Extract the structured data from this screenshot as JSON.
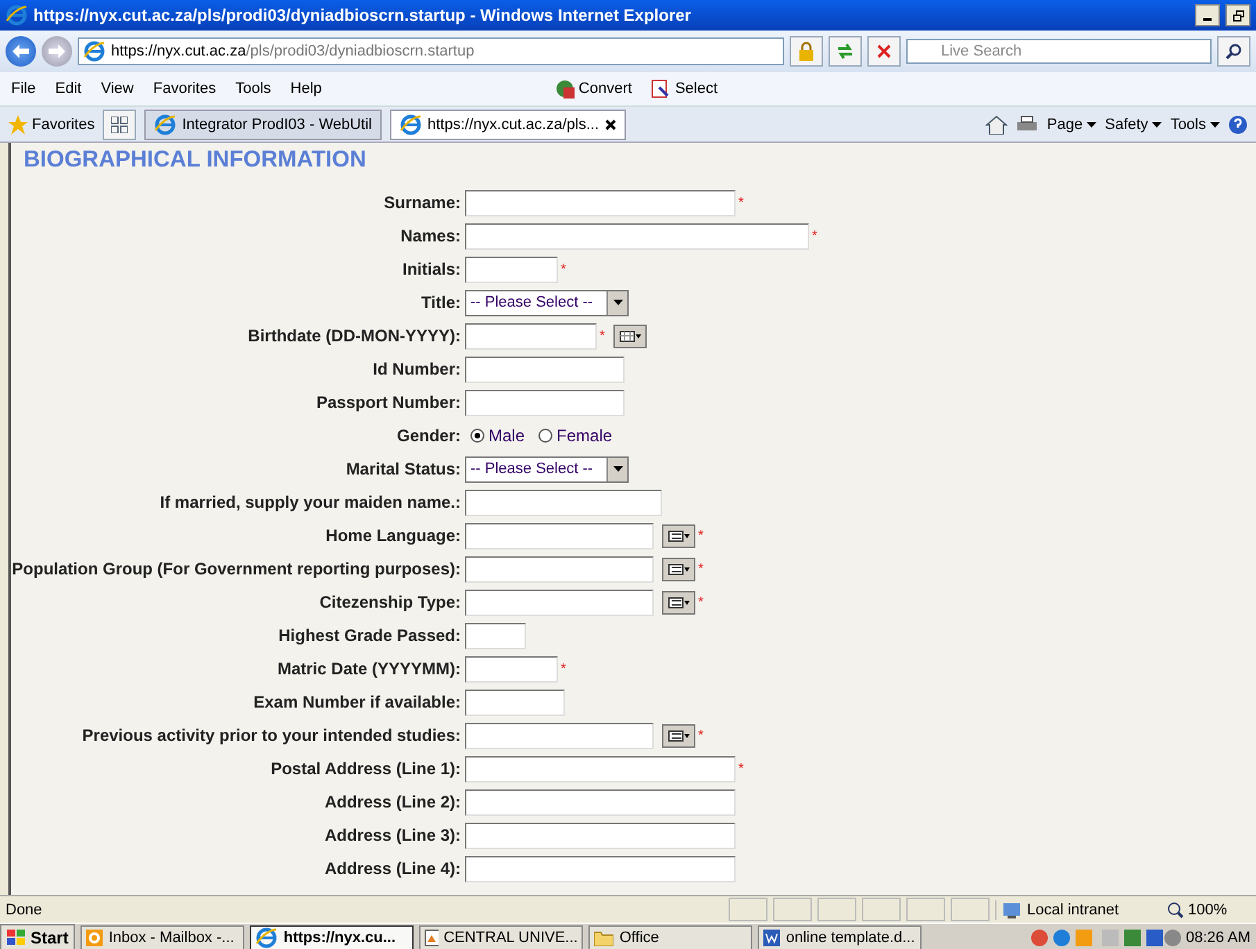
{
  "window": {
    "title": "https://nyx.cut.ac.za/pls/prodi03/dyniadbioscrn.startup - Windows Internet Explorer"
  },
  "address_bar": {
    "url_host": "https://nyx.cut.ac.za",
    "url_path": "/pls/prodi03/dyniadbioscrn.startup",
    "search_placeholder": "Live Search"
  },
  "menu": [
    "File",
    "Edit",
    "View",
    "Favorites",
    "Tools",
    "Help"
  ],
  "toolbar": [
    {
      "label": "Convert",
      "kind": "convert"
    },
    {
      "label": "Select",
      "kind": "select"
    }
  ],
  "favorites_label": "Favorites",
  "tabs": [
    {
      "label": "Integrator ProdI03 - WebUtil",
      "selected": false
    },
    {
      "label": "https://nyx.cut.ac.za/pls...",
      "selected": true
    }
  ],
  "command_bar": [
    "Page",
    "Safety",
    "Tools"
  ],
  "page": {
    "heading": "BIOGRAPHICAL INFORMATION",
    "fields": [
      {
        "label": "Surname:",
        "kind": "text",
        "mark": "*"
      },
      {
        "label": "Names:",
        "kind": "text",
        "mark": "*"
      },
      {
        "label": "Initials:",
        "kind": "text",
        "mark": "*"
      },
      {
        "label": "Title:",
        "kind": "select",
        "value": "-- Please Select --"
      },
      {
        "label": "Birthdate (DD-MON-YYYY):",
        "kind": "date",
        "mark": "*"
      },
      {
        "label": "Id Number:",
        "kind": "text"
      },
      {
        "label": "Passport Number:",
        "kind": "text"
      },
      {
        "label": "Gender:",
        "kind": "radio",
        "options": [
          {
            "label": "Male",
            "selected": true
          },
          {
            "label": "Female",
            "selected": false
          }
        ]
      },
      {
        "label": "Marital Status:",
        "kind": "select",
        "value": "-- Please Select --"
      },
      {
        "label": "If married, supply your maiden name.:",
        "kind": "text"
      },
      {
        "label": "Home Language:",
        "kind": "lookup",
        "mark": "*"
      },
      {
        "label": "Population Group (For Government reporting purposes):",
        "kind": "lookup",
        "mark": "*"
      },
      {
        "label": "Citezenship Type:",
        "kind": "lookup",
        "mark": "*"
      },
      {
        "label": "Highest Grade Passed:",
        "kind": "text"
      },
      {
        "label": "Matric Date (YYYYMM):",
        "kind": "text",
        "mark": "*"
      },
      {
        "label": "Exam Number if available:",
        "kind": "text"
      },
      {
        "label": "Previous activity prior to your intended studies:",
        "kind": "lookup",
        "mark": "*"
      },
      {
        "label": "Postal Address (Line 1):",
        "kind": "text",
        "mark": "*"
      },
      {
        "label": "Address (Line 2):",
        "kind": "text"
      },
      {
        "label": "Address (Line 3):",
        "kind": "text"
      },
      {
        "label": "Address (Line 4):",
        "kind": "text"
      }
    ]
  },
  "status_bar": {
    "text": "Done",
    "zone": "Local intranet",
    "zoom": "100%"
  },
  "taskbar": {
    "start": "Start",
    "items": [
      {
        "label": "Inbox - Mailbox -...",
        "kind": "mail",
        "selected": false
      },
      {
        "label": "https://nyx.cu...",
        "kind": "browser",
        "selected": true
      },
      {
        "label": "CENTRAL UNIVE...",
        "kind": "app",
        "selected": false
      },
      {
        "label": "Office",
        "kind": "folder",
        "selected": false
      },
      {
        "label": "online template.d...",
        "kind": "word",
        "selected": false
      }
    ],
    "clock": "08:26 AM"
  }
}
